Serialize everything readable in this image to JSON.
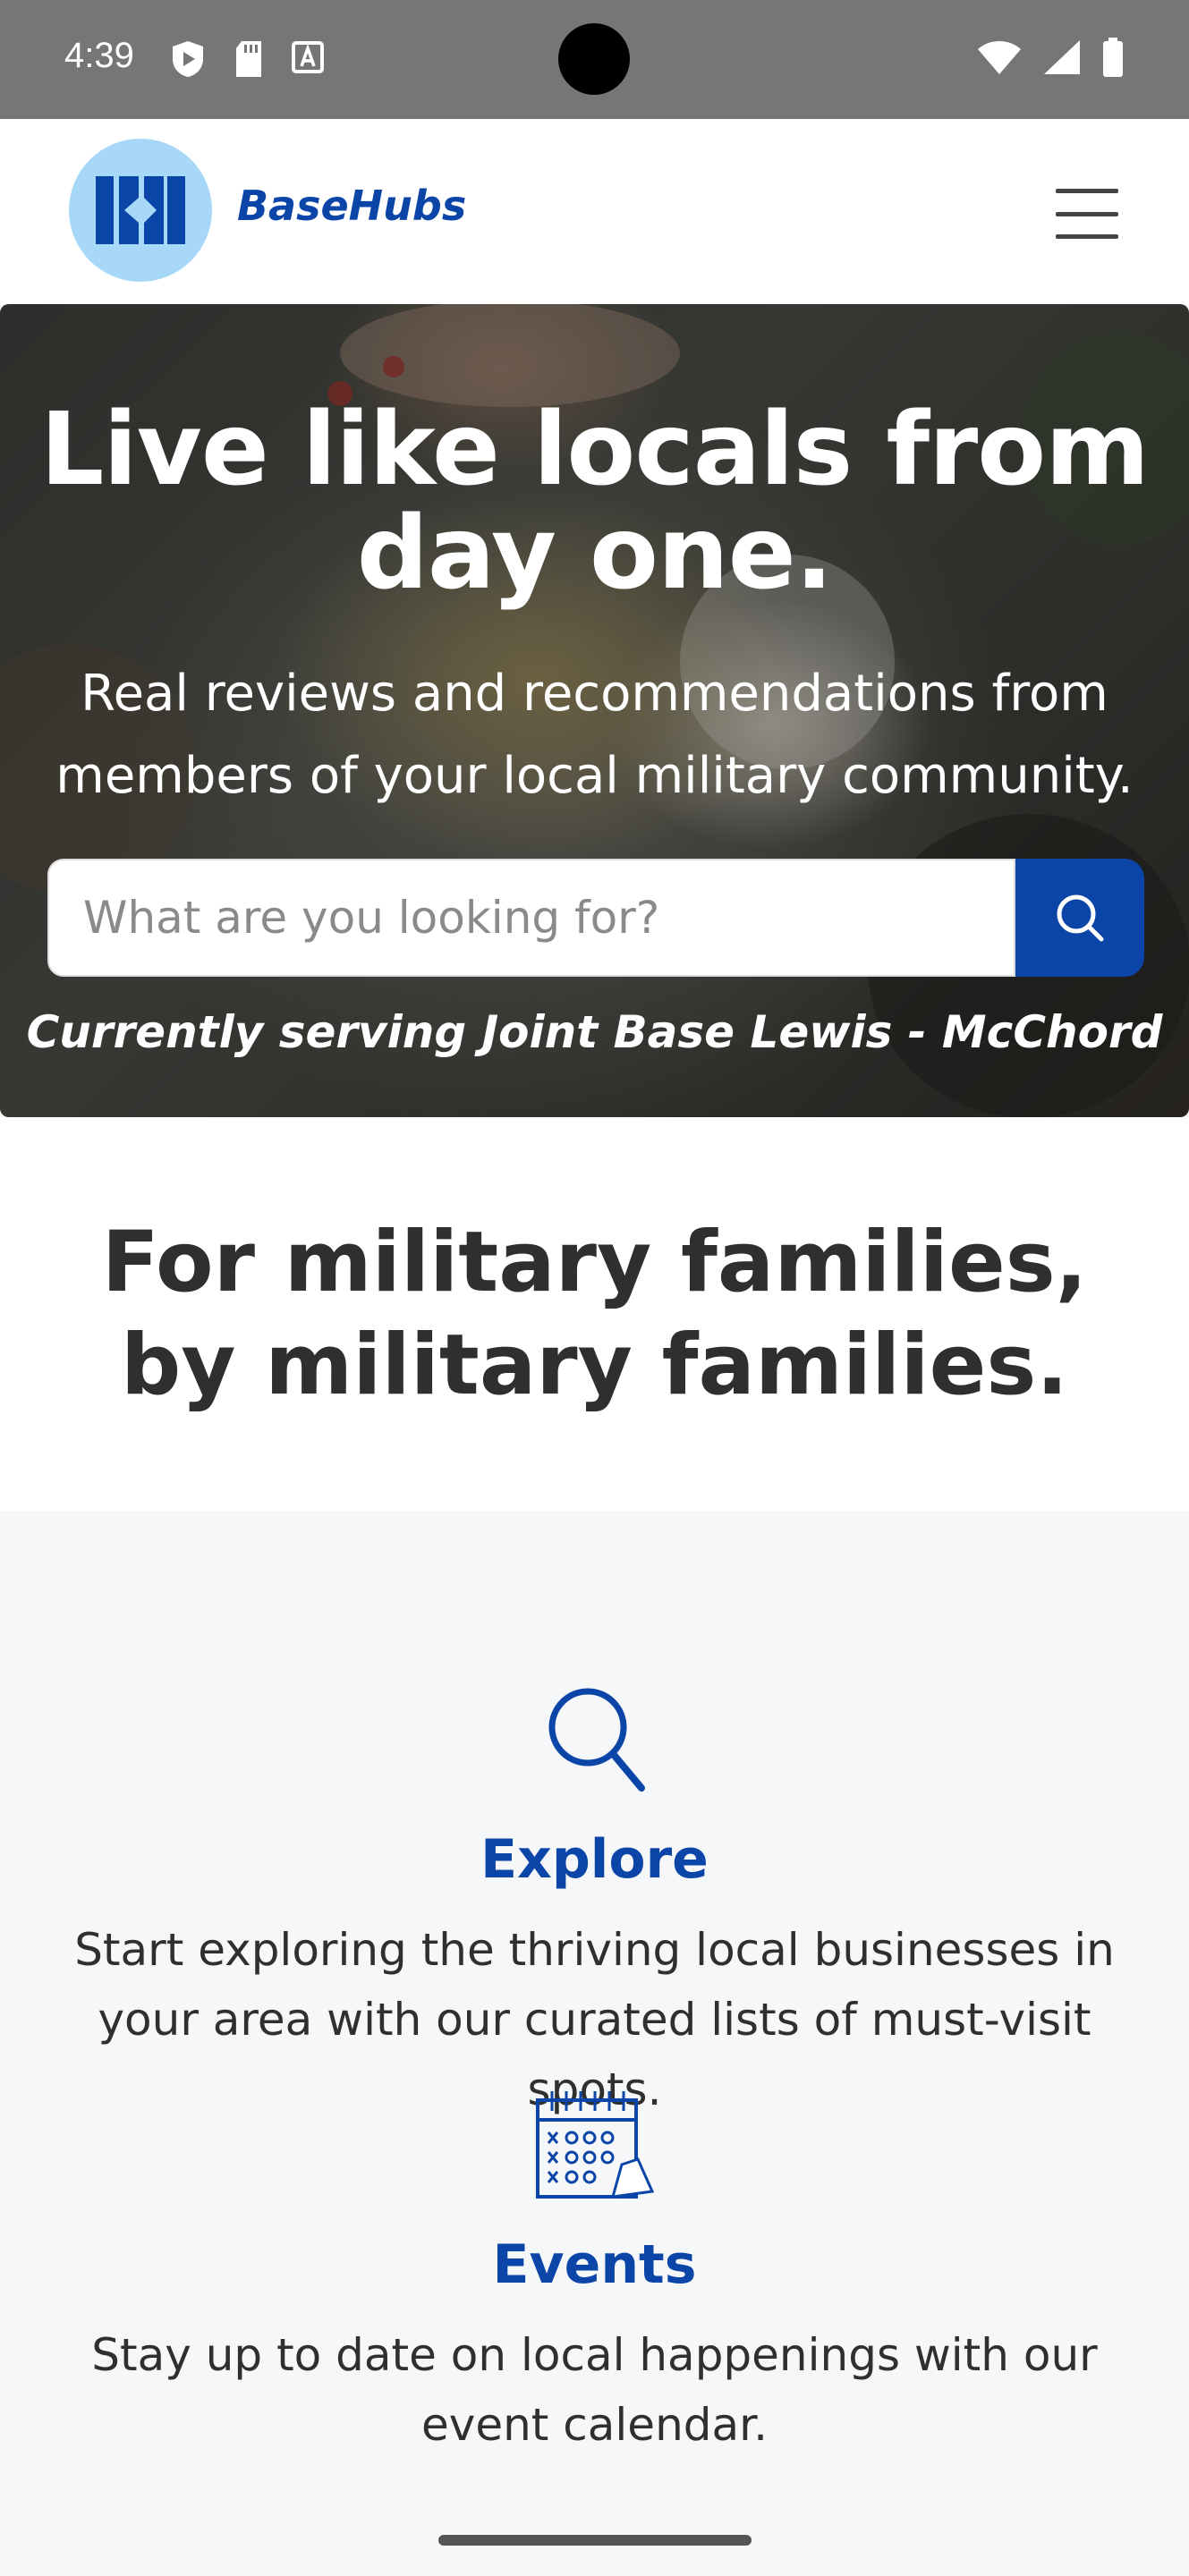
{
  "status_bar": {
    "time": "4:39",
    "icons": [
      "shield-icon",
      "sd-card-icon",
      "font-a-icon",
      "wifi-icon",
      "signal-icon",
      "battery-icon"
    ]
  },
  "header": {
    "brand": "BaseHubs",
    "menu_icon": "hamburger-menu-icon"
  },
  "hero": {
    "title": "Live like locals from day one.",
    "subtitle": "Real reviews and recommendations from members of your local military community.",
    "search_placeholder": "What are you looking for?",
    "serving": "Currently serving Joint Base Lewis - McChord"
  },
  "tagline": "For military families, by military families.",
  "features": [
    {
      "icon": "search-icon",
      "title": "Explore",
      "description": "Start exploring the thriving local businesses in your area with our curated lists of must-visit spots."
    },
    {
      "icon": "calendar-icon",
      "title": "Events",
      "description": "Stay up to date on local happenings with our event calendar."
    }
  ],
  "colors": {
    "brand": "#0b45a8",
    "logo_bg": "#a8d8f8",
    "status_bar": "#767676",
    "section_bg": "#f6f7f9"
  }
}
